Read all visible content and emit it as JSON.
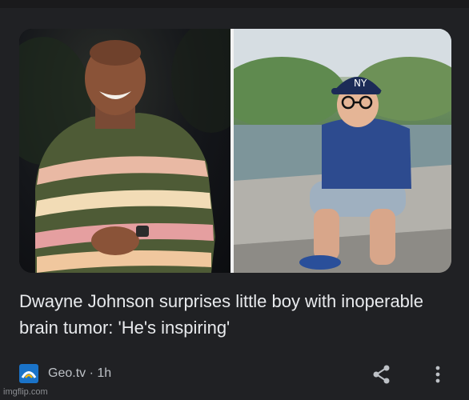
{
  "article": {
    "headline": "Dwayne Johnson surprises little boy with inoperable brain tumor: 'He's inspiring'",
    "source": "Geo.tv",
    "separator": "·",
    "time": "1h",
    "images": [
      "man-in-striped-sweater-photo",
      "boy-in-ny-cap-photo"
    ]
  },
  "actions": {
    "share_icon": "share-icon",
    "more_icon": "more-vert-icon"
  },
  "watermark": "imgflip.com",
  "colors": {
    "background": "#202124",
    "headline_text": "#e8eaed",
    "meta_text": "#bdc1c6",
    "geo_logo_blue": "#1a73c8"
  }
}
